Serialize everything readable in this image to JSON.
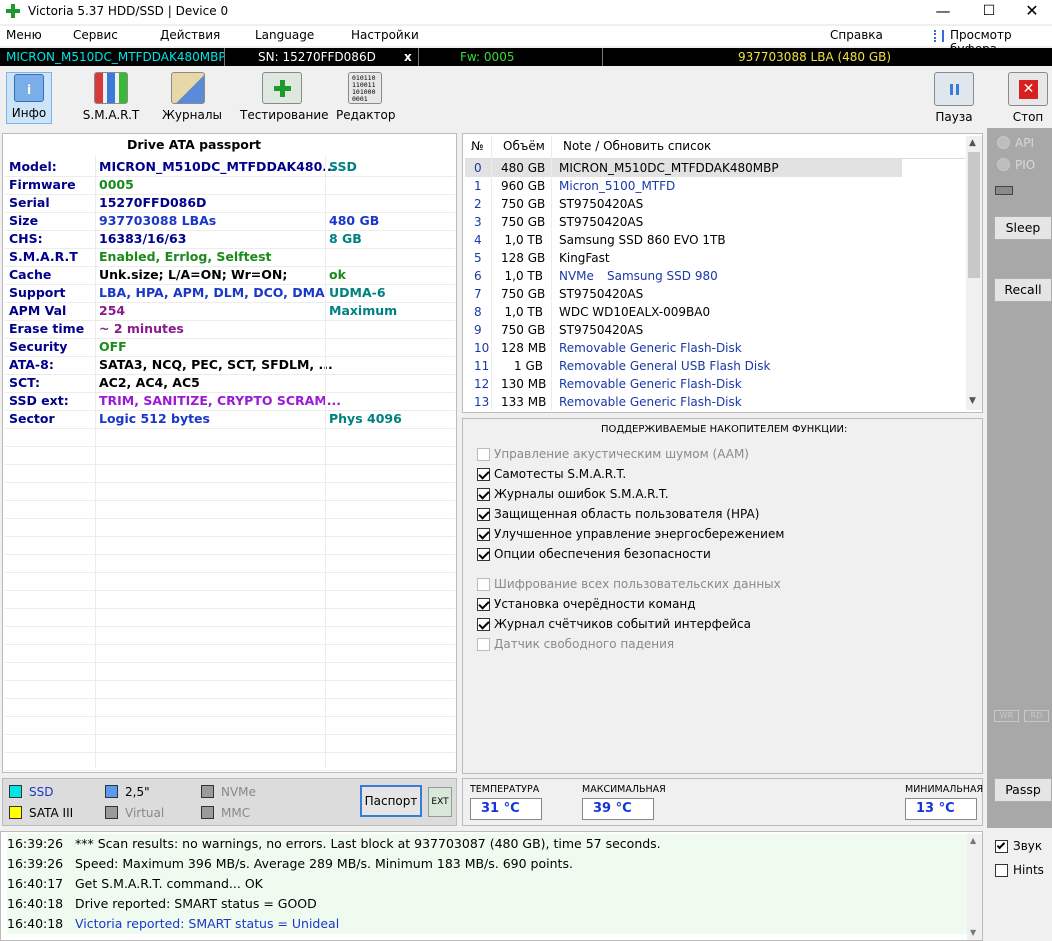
{
  "window": {
    "title": "Victoria 5.37 HDD/SSD | Device 0"
  },
  "menu": [
    "Меню",
    "Сервис",
    "Действия",
    "Language",
    "Настройки"
  ],
  "menu_right": {
    "help": "Справка",
    "clipboard": "Просмотр буфера"
  },
  "drive_bar": {
    "model": "MICRON_M510DC_MTFDDAK480MBP",
    "serial": "SN: 15270FFD086D",
    "close": "x",
    "firmware": "Fw: 0005",
    "capacity": "937703088 LBA (480 GB)"
  },
  "toolbar": {
    "info": "Инфо",
    "smart": "S.M.A.R.T",
    "logs": "Журналы",
    "test": "Тестирование",
    "editor": "Редактор",
    "pause": "Пауза",
    "stop": "Стоп",
    "editor_icon_text": "010110 110011 101000 0001"
  },
  "passport": {
    "title": "Drive ATA passport",
    "rows": [
      {
        "label": "Model:",
        "value": "MICRON_M510DC_MTFDDAK480...",
        "extra": "SSD",
        "vc": "#00008b",
        "ec": "#008080"
      },
      {
        "label": "Firmware",
        "value": "0005",
        "extra": "",
        "vc": "#1a8a1a",
        "ec": "#1a8a1a"
      },
      {
        "label": "Serial",
        "value": "15270FFD086D",
        "extra": "",
        "vc": "#00008b",
        "ec": "#00008b"
      },
      {
        "label": "Size",
        "value": "937703088 LBAs",
        "extra": "480 GB",
        "vc": "#1a38c8",
        "ec": "#1a38c8"
      },
      {
        "label": "CHS:",
        "value": "16383/16/63",
        "extra": "8 GB",
        "vc": "#00008b",
        "ec": "#008080"
      },
      {
        "label": "S.M.A.R.T",
        "value": "Enabled, Errlog, Selftest",
        "extra": "",
        "vc": "#1a8a1a",
        "ec": "#1a8a1a"
      },
      {
        "label": "Cache",
        "value": "Unk.size; L/A=ON; Wr=ON;",
        "extra": "ok",
        "vc": "#000000",
        "ec": "#1a8a1a"
      },
      {
        "label": "Support",
        "value": "LBA, HPA, APM, DLM, DCO, DMA",
        "extra": "UDMA-6",
        "vc": "#1a38c8",
        "ec": "#008080"
      },
      {
        "label": "APM Val",
        "value": "254",
        "extra": "Maximum",
        "vc": "#8b1a8b",
        "ec": "#008080"
      },
      {
        "label": "Erase time",
        "value": "~ 2 minutes",
        "extra": "",
        "vc": "#8b1a8b",
        "ec": "#8b1a8b"
      },
      {
        "label": "Security",
        "value": "OFF",
        "extra": "",
        "vc": "#1a8a1a",
        "ec": "#1a8a1a"
      },
      {
        "label": "ATA-8:",
        "value": "SATA3, NCQ, PEC, SCT, SFDLM, ...",
        "extra": "",
        "vc": "#000000",
        "ec": "#000000"
      },
      {
        "label": "SCT:",
        "value": "AC2, AC4, AC5",
        "extra": "",
        "vc": "#000000",
        "ec": "#000000"
      },
      {
        "label": "SSD ext:",
        "value": "TRIM, SANITIZE, CRYPTO SCRAM...",
        "extra": "",
        "vc": "#9b1ad8",
        "ec": "#9b1ad8"
      },
      {
        "label": "Sector",
        "value": "Logic 512 bytes",
        "extra": "Phys 4096",
        "vc": "#1a38c8",
        "ec": "#008080"
      }
    ]
  },
  "drive_list": {
    "headers": {
      "num": "№",
      "size": "Объём",
      "note": "Note / Обновить список"
    },
    "rows": [
      {
        "n": "0",
        "size": "480 GB",
        "name": "MICRON_M510DC_MTFDDAK480MBP",
        "pre": "",
        "color": "#000000",
        "sel": true
      },
      {
        "n": "1",
        "size": "960 GB",
        "name": "Micron_5100_MTFD",
        "pre": "",
        "color": "#1a38a8",
        "sel": false
      },
      {
        "n": "2",
        "size": "750 GB",
        "name": "ST9750420AS",
        "pre": "",
        "color": "#000000",
        "sel": false
      },
      {
        "n": "3",
        "size": "750 GB",
        "name": "ST9750420AS",
        "pre": "",
        "color": "#000000",
        "sel": false
      },
      {
        "n": "4",
        "size": "1,0 TB",
        "name": "Samsung SSD 860 EVO 1TB",
        "pre": "",
        "color": "#000000",
        "sel": false
      },
      {
        "n": "5",
        "size": "128 GB",
        "name": "KingFast",
        "pre": "",
        "color": "#000000",
        "sel": false
      },
      {
        "n": "6",
        "size": "1,0 TB",
        "name": "Samsung SSD 980",
        "pre": "NVMe",
        "color": "#1a38a8",
        "sel": false
      },
      {
        "n": "7",
        "size": "750 GB",
        "name": "ST9750420AS",
        "pre": "",
        "color": "#000000",
        "sel": false
      },
      {
        "n": "8",
        "size": "1,0 TB",
        "name": "WDC WD10EALX-009BA0",
        "pre": "",
        "color": "#000000",
        "sel": false
      },
      {
        "n": "9",
        "size": "750 GB",
        "name": "ST9750420AS",
        "pre": "",
        "color": "#000000",
        "sel": false
      },
      {
        "n": "10",
        "size": "128 MB",
        "name": "Removable Generic Flash-Disk",
        "pre": "",
        "color": "#1a38a8",
        "sel": false
      },
      {
        "n": "11",
        "size": "1 GB",
        "name": "Removable General USB Flash Disk",
        "pre": "",
        "color": "#1a38a8",
        "sel": false
      },
      {
        "n": "12",
        "size": "130 MB",
        "name": "Removable Generic Flash-Disk",
        "pre": "",
        "color": "#1a38a8",
        "sel": false
      },
      {
        "n": "13",
        "size": "133 MB",
        "name": "Removable Generic Flash-Disk",
        "pre": "",
        "color": "#1a38a8",
        "sel": false
      }
    ]
  },
  "features": {
    "title": "ПОДДЕРЖИВАЕМЫЕ НАКОПИТЕЛЕМ ФУНКЦИИ:",
    "items": [
      {
        "label": "Управление акустическим шумом (AAM)",
        "checked": false,
        "enabled": false
      },
      {
        "label": "Самотесты S.M.A.R.T.",
        "checked": true,
        "enabled": true
      },
      {
        "label": "Журналы ошибок S.M.A.R.T.",
        "checked": true,
        "enabled": true
      },
      {
        "label": "Защищенная область пользователя (HPA)",
        "checked": true,
        "enabled": true
      },
      {
        "label": "Улучшенное управление энергосбережением",
        "checked": true,
        "enabled": true
      },
      {
        "label": "Опции обеспечения безопасности",
        "checked": true,
        "enabled": true
      },
      {
        "label": "Шифрование всех пользовательских данных",
        "checked": false,
        "enabled": false
      },
      {
        "label": "Установка очерёдности команд",
        "checked": true,
        "enabled": true
      },
      {
        "label": "Журнал счётчиков событий интерфейса",
        "checked": true,
        "enabled": true
      },
      {
        "label": "Датчик свободного падения",
        "checked": false,
        "enabled": false
      }
    ]
  },
  "right_panel": {
    "api": "API",
    "pio": "PIO",
    "sleep": "Sleep",
    "recall": "Recall",
    "wr": "WR",
    "rd": "RD",
    "passp": "Passp"
  },
  "legend": {
    "ssd": "SSD",
    "hdd": "2,5\"",
    "nvme": "NVMe",
    "sata": "SATA III",
    "virtual": "Virtual",
    "mmc": "MMC",
    "passport_btn": "Паспорт",
    "ext_btn": "EXT",
    "colors": {
      "ssd": "#00e5e5",
      "hdd": "#5a9af0",
      "sata": "#ffff00",
      "virtual": "#9a9a9a",
      "nvme": "#9a9a9a",
      "mmc": "#9a9a9a"
    }
  },
  "temps": {
    "current_label": "ТЕМПЕРАТУРА",
    "current": "31 °C",
    "max_label": "МАКСИМАЛЬНАЯ",
    "max": "39 °C",
    "min_label": "МИНИМАЛЬНАЯ",
    "min": "13 °C"
  },
  "log": [
    {
      "time": "16:39:26",
      "msg": "*** Scan results: no warnings, no errors. Last block at 937703087 (480 GB), time 57 seconds.",
      "color": "#000000"
    },
    {
      "time": "16:39:26",
      "msg": "Speed: Maximum 396 MB/s. Average 289 MB/s. Minimum 183 MB/s. 690 points.",
      "color": "#000000"
    },
    {
      "time": "16:40:17",
      "msg": "Get S.M.A.R.T. command... OK",
      "color": "#000000"
    },
    {
      "time": "16:40:18",
      "msg": "Drive reported: SMART status = GOOD",
      "color": "#000000"
    },
    {
      "time": "16:40:18",
      "msg": "Victoria reported: SMART status = Unideal",
      "color": "#1a38c8"
    }
  ],
  "options": {
    "sound": "Звук",
    "hints": "Hints"
  }
}
